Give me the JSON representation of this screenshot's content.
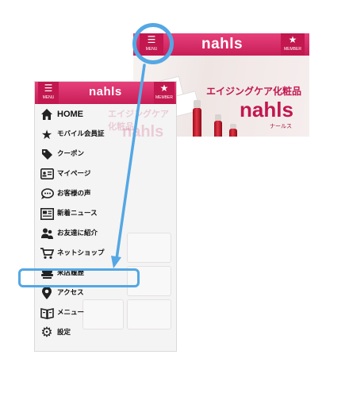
{
  "header": {
    "menu_caption": "MENU",
    "member_caption": "MEMBER",
    "logo": "nahls",
    "menu_icon": "hamburger-icon",
    "member_icon": "star-icon"
  },
  "banner": {
    "tagline": "エイジングケア化粧品",
    "brand": "nahls",
    "brand_kana": "ナールス"
  },
  "menu": {
    "items": [
      {
        "label": "HOME",
        "icon": "home-icon"
      },
      {
        "label": "モバイル会員証",
        "icon": "star-icon"
      },
      {
        "label": "クーポン",
        "icon": "tag-icon"
      },
      {
        "label": "マイページ",
        "icon": "id-card-icon"
      },
      {
        "label": "お客様の声",
        "icon": "speech-bubble-icon"
      },
      {
        "label": "新着ニュース",
        "icon": "news-icon"
      },
      {
        "label": "お友達に紹介",
        "icon": "friends-icon"
      },
      {
        "label": "ネットショップ",
        "icon": "cart-icon"
      },
      {
        "label": "来店履歴",
        "icon": "stamp-icon"
      },
      {
        "label": "アクセス",
        "icon": "map-pin-icon"
      },
      {
        "label": "メニュー",
        "icon": "book-icon"
      },
      {
        "label": "設定",
        "icon": "gear-icon"
      }
    ],
    "highlighted": "来店履歴"
  },
  "colors": {
    "brand": "#c81e58",
    "annotation": "#54a7e4"
  }
}
